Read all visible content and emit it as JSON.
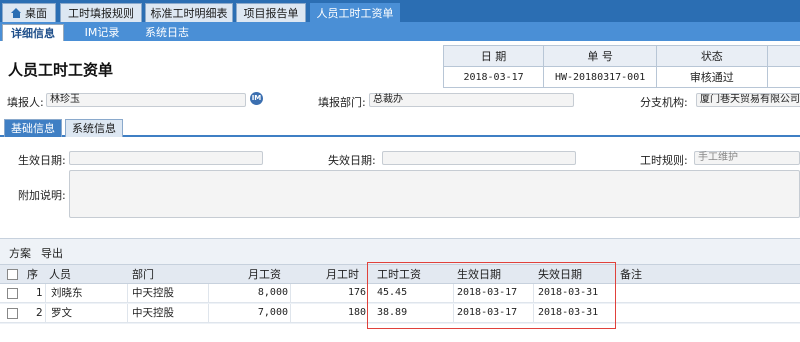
{
  "top_tabs": [
    {
      "label": "桌面"
    },
    {
      "label": "工时填报规则"
    },
    {
      "label": "标准工时明细表"
    },
    {
      "label": "项目报告单"
    },
    {
      "label": "人员工时工资单"
    }
  ],
  "sub_tabs": [
    "详细信息",
    "IM记录",
    "系统日志"
  ],
  "page_title": "人员工时工资单",
  "info": {
    "date_label": "日 期",
    "no_label": "单 号",
    "status_label": "状态",
    "date_value": "2018-03-17",
    "no_value": "HW-20180317-001",
    "status_value": "审核通过"
  },
  "form": {
    "reporter_label": "填报人:",
    "reporter_value": "林珍玉",
    "im_label": "IM",
    "dept_label": "填报部门:",
    "dept_value": "总裁办",
    "branch_label": "分支机构:",
    "branch_value": "厦门巷天贸易有限公司",
    "effective_label": "生效日期:",
    "expire_label": "失效日期:",
    "rule_label": "工时规则:",
    "rule_value": "手工维护",
    "remark_label": "附加说明:"
  },
  "inner_tabs": [
    "基础信息",
    "系统信息"
  ],
  "grid": {
    "toolbar": [
      "方案",
      "导出"
    ],
    "headers": {
      "seq": "序",
      "person": "人员",
      "dept": "部门",
      "monthly_wage": "月工资",
      "monthly_hours": "月工时",
      "hourly_wage": "工时工资",
      "effective_date": "生效日期",
      "expire_date": "失效日期",
      "note": "备注"
    },
    "rows": [
      {
        "seq": "1",
        "person": "刘晓东",
        "dept": "中天控股",
        "monthly_wage": "8,000",
        "monthly_hours": "176",
        "hourly_wage": "45.45",
        "effective_date": "2018-03-17",
        "expire_date": "2018-03-31"
      },
      {
        "seq": "2",
        "person": "罗文",
        "dept": "中天控股",
        "monthly_wage": "7,000",
        "monthly_hours": "180",
        "hourly_wage": "38.89",
        "effective_date": "2018-03-17",
        "expire_date": "2018-03-31"
      }
    ]
  },
  "colors": {
    "accent": "#2b6eb3",
    "highlight": "#e0413b"
  }
}
